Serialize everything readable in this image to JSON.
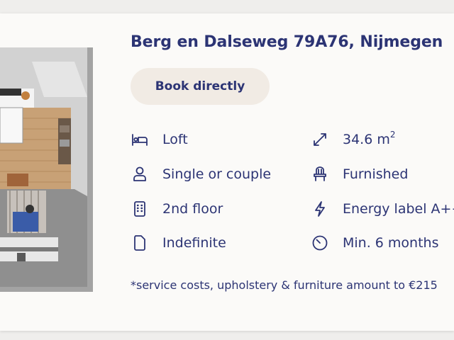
{
  "listing": {
    "title": "Berg en Dalseweg 79A76, Nijmegen",
    "book_label": "Book directly",
    "floorplan_alt": "Floor plan"
  },
  "features": [
    {
      "icon": "bed-icon",
      "label": "Loft"
    },
    {
      "icon": "expand-icon",
      "label": "34.6 m",
      "sup": "2"
    },
    {
      "icon": "person-icon",
      "label": "Single or couple"
    },
    {
      "icon": "chair-icon",
      "label": "Furnished"
    },
    {
      "icon": "building-icon",
      "label": "2nd floor"
    },
    {
      "icon": "lightning-icon",
      "label": "Energy label A++"
    },
    {
      "icon": "document-icon",
      "label": "Indefinite"
    },
    {
      "icon": "clock-icon",
      "label": "Min. 6 months"
    }
  ],
  "footnote": "*service costs, upholstery & furniture amount to €215",
  "colors": {
    "primary": "#2c3474",
    "button_bg": "#f1ebe4",
    "card_bg": "#fbfaf8",
    "page_bg": "#efeeec"
  }
}
